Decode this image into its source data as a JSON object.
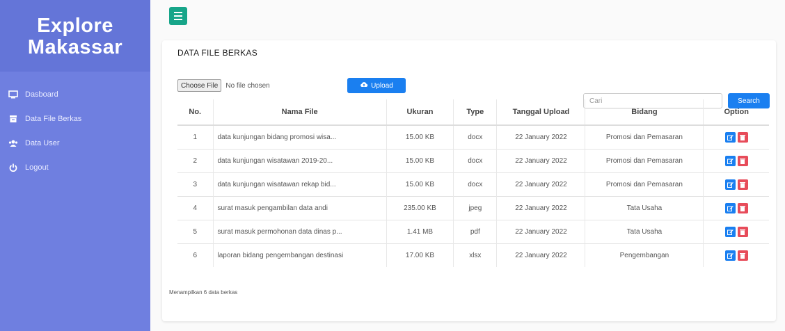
{
  "sidebar": {
    "brand_line1": "Explore",
    "brand_line2": "Makassar",
    "items": [
      {
        "label": "Dasboard",
        "icon": "monitor-icon"
      },
      {
        "label": "Data File Berkas",
        "icon": "archive-icon"
      },
      {
        "label": "Data User",
        "icon": "users-icon"
      },
      {
        "label": "Logout",
        "icon": "power-icon"
      }
    ]
  },
  "main": {
    "card_title": "DATA FILE BERKAS",
    "file_button": "Choose File",
    "file_status": "No file chosen",
    "upload_label": "Upload",
    "search_placeholder": "Cari",
    "search_label": "Search",
    "table": {
      "headers": [
        "No.",
        "Nama File",
        "Ukuran",
        "Type",
        "Tanggal Upload",
        "Bidang",
        "Option"
      ],
      "rows": [
        [
          "1",
          "data kunjungan bidang promosi wisa...",
          "15.00 KB",
          "docx",
          "22 January 2022",
          "Promosi dan Pemasaran"
        ],
        [
          "2",
          "data kunjungan wisatawan 2019-20...",
          "15.00 KB",
          "docx",
          "22 January 2022",
          "Promosi dan Pemasaran"
        ],
        [
          "3",
          "data kunjungan wisatawan rekap bid...",
          "15.00 KB",
          "docx",
          "22 January 2022",
          "Promosi dan Pemasaran"
        ],
        [
          "4",
          "surat masuk pengambilan data andi",
          "235.00 KB",
          "jpeg",
          "22 January 2022",
          "Tata Usaha"
        ],
        [
          "5",
          "surat masuk permohonan data dinas p...",
          "1.41 MB",
          "pdf",
          "22 January 2022",
          "Tata Usaha"
        ],
        [
          "6",
          "laporan bidang pengembangan destinasi",
          "17.00 KB",
          "xlsx",
          "22 January 2022",
          "Pengembangan"
        ]
      ]
    },
    "footer": "Menampilkan 6 data berkas"
  }
}
